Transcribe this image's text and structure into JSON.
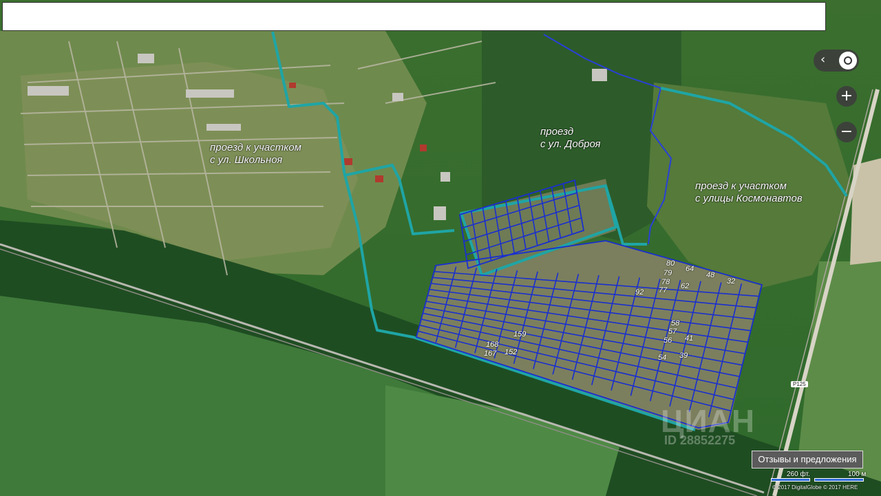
{
  "labels": {
    "road_school": [
      "проезд к участком",
      "с ул. Школьноя"
    ],
    "road_dobraya": [
      "проезд",
      "с ул. Доброя"
    ],
    "road_kosmonavtov": [
      "проезд к участком",
      "с улицы Космонавтов"
    ]
  },
  "plot_numbers": {
    "n80": "80",
    "n64": "64",
    "n48": "48",
    "n32": "32",
    "n79": "79",
    "n78": "78",
    "n62": "62",
    "n77": "77",
    "n92": "92",
    "n58": "58",
    "n57": "57",
    "n41": "41",
    "n56": "56",
    "n54": "54",
    "n39": "39",
    "n159": "159",
    "n168": "168",
    "n167": "167",
    "n152": "152"
  },
  "controls": {
    "zoom_in": "+",
    "zoom_out": "−",
    "collapse": "‹",
    "icons": [
      "chevron-left-icon",
      "geolocation-icon",
      "plus-icon",
      "minus-icon"
    ]
  },
  "feedback_label": "Отзывы и предложения",
  "scale": {
    "feet": "260 фт.",
    "meters": "100 м"
  },
  "copyright": "© 2017 DigitalGlobe © 2017 HERE",
  "road_sign": "Р125",
  "watermark": {
    "text": "Циан",
    "id": "ID 28852275"
  },
  "colors": {
    "access_road": "#1fa5a5",
    "plot_grid": "#1a2fcf",
    "stream": "#2940d8"
  }
}
